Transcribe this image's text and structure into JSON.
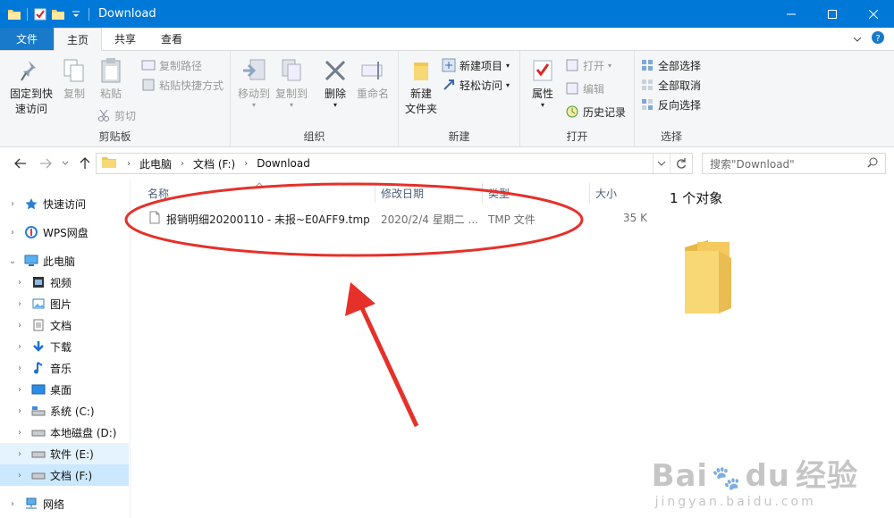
{
  "window": {
    "title": "Download"
  },
  "ribbon_tabs": [
    "文件",
    "主页",
    "共享",
    "查看"
  ],
  "ribbon": {
    "clipboard": {
      "title": "剪贴板",
      "pin_l1": "固定到快",
      "pin_l2": "速访问",
      "copy": "复制",
      "paste": "粘贴",
      "copy_path": "复制路径",
      "paste_shortcut": "粘贴快捷方式",
      "cut": "剪切"
    },
    "organize": {
      "title": "组织",
      "move_to": "移动到",
      "copy_to": "复制到",
      "delete": "删除",
      "rename": "重命名"
    },
    "new": {
      "title": "新建",
      "folder_l1": "新建",
      "folder_l2": "文件夹",
      "new_item": "新建项目",
      "easy_access": "轻松访问"
    },
    "open": {
      "title": "打开",
      "properties": "属性",
      "open": "打开",
      "edit": "编辑",
      "history": "历史记录"
    },
    "select": {
      "title": "选择",
      "select_all": "全部选择",
      "select_none": "全部取消",
      "invert": "反向选择"
    }
  },
  "address": {
    "crumbs": [
      "此电脑",
      "文档 (F:)",
      "Download"
    ],
    "search_placeholder": "搜索\"Download\""
  },
  "nav": [
    {
      "label": "快速访问",
      "icon": "star-icon",
      "level": 0
    },
    {
      "label": "WPS网盘",
      "icon": "cloud-icon",
      "level": 0
    },
    {
      "label": "此电脑",
      "icon": "computer-icon",
      "level": 0
    },
    {
      "label": "视频",
      "icon": "video-icon",
      "level": 1
    },
    {
      "label": "图片",
      "icon": "pictures-icon",
      "level": 1
    },
    {
      "label": "文档",
      "icon": "documents-icon",
      "level": 1
    },
    {
      "label": "下载",
      "icon": "download-icon",
      "level": 1
    },
    {
      "label": "音乐",
      "icon": "music-icon",
      "level": 1
    },
    {
      "label": "桌面",
      "icon": "desktop-icon",
      "level": 1
    },
    {
      "label": "系统 (C:)",
      "icon": "drive-icon",
      "level": 1
    },
    {
      "label": "本地磁盘 (D:)",
      "icon": "drive-icon",
      "level": 1
    },
    {
      "label": "软件 (E:)",
      "icon": "drive-icon",
      "level": 1
    },
    {
      "label": "文档 (F:)",
      "icon": "drive-icon",
      "level": 1
    },
    {
      "label": "网络",
      "icon": "network-icon",
      "level": 0
    }
  ],
  "columns": {
    "name": "名称",
    "date": "修改日期",
    "type": "类型",
    "size": "大小"
  },
  "files": [
    {
      "name": "报销明细20200110 - 未报~E0AFF9.tmp",
      "date": "2020/2/4 星期二 ...",
      "type": "TMP 文件",
      "size": "35 K"
    }
  ],
  "preview": {
    "title": "1 个对象"
  },
  "watermark": {
    "brand": "Bai",
    "brand2": "du",
    "brand_cn": "经验",
    "url": "jingyan.baidu.com"
  }
}
